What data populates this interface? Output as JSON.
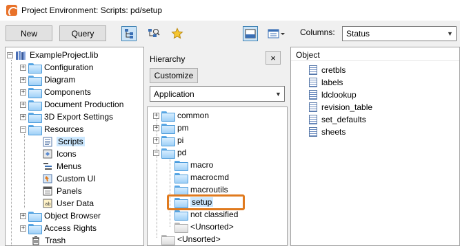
{
  "window": {
    "title": "Project Environment: Scripts: pd/setup"
  },
  "toolbar": {
    "new_label": "New",
    "query_label": "Query",
    "columns_label": "Columns:",
    "columns_value": "Status"
  },
  "left_tree": {
    "root": "ExampleProject.lib",
    "items": [
      {
        "label": "Configuration"
      },
      {
        "label": "Diagram"
      },
      {
        "label": "Components"
      },
      {
        "label": "Document Production"
      },
      {
        "label": "3D Export Settings"
      },
      {
        "label": "Resources"
      },
      {
        "label": "Scripts"
      },
      {
        "label": "Icons"
      },
      {
        "label": "Menus"
      },
      {
        "label": "Custom UI"
      },
      {
        "label": "Panels"
      },
      {
        "label": "User Data"
      },
      {
        "label": "Object Browser"
      },
      {
        "label": "Access Rights"
      },
      {
        "label": "Trash"
      }
    ]
  },
  "hierarchy": {
    "title": "Hierarchy",
    "close_label": "×",
    "customize_label": "Customize",
    "dropdown_value": "Application",
    "tree": [
      {
        "label": "common"
      },
      {
        "label": "pm"
      },
      {
        "label": "pi"
      },
      {
        "label": "pd"
      },
      {
        "label": "macro"
      },
      {
        "label": "macrocmd"
      },
      {
        "label": "macroutils"
      },
      {
        "label": "setup"
      },
      {
        "label": "not classified"
      },
      {
        "label": "<Unsorted>"
      },
      {
        "label": "<Unsorted>"
      }
    ]
  },
  "objects": {
    "header": "Object",
    "items": [
      {
        "label": "cretbls"
      },
      {
        "label": "labels"
      },
      {
        "label": "ldclookup"
      },
      {
        "label": "revision_table"
      },
      {
        "label": "set_defaults"
      },
      {
        "label": "sheets"
      }
    ]
  },
  "colors": {
    "highlight": "#e07a1e",
    "selection": "#cce8ff",
    "folder": "#9fd0f7"
  }
}
